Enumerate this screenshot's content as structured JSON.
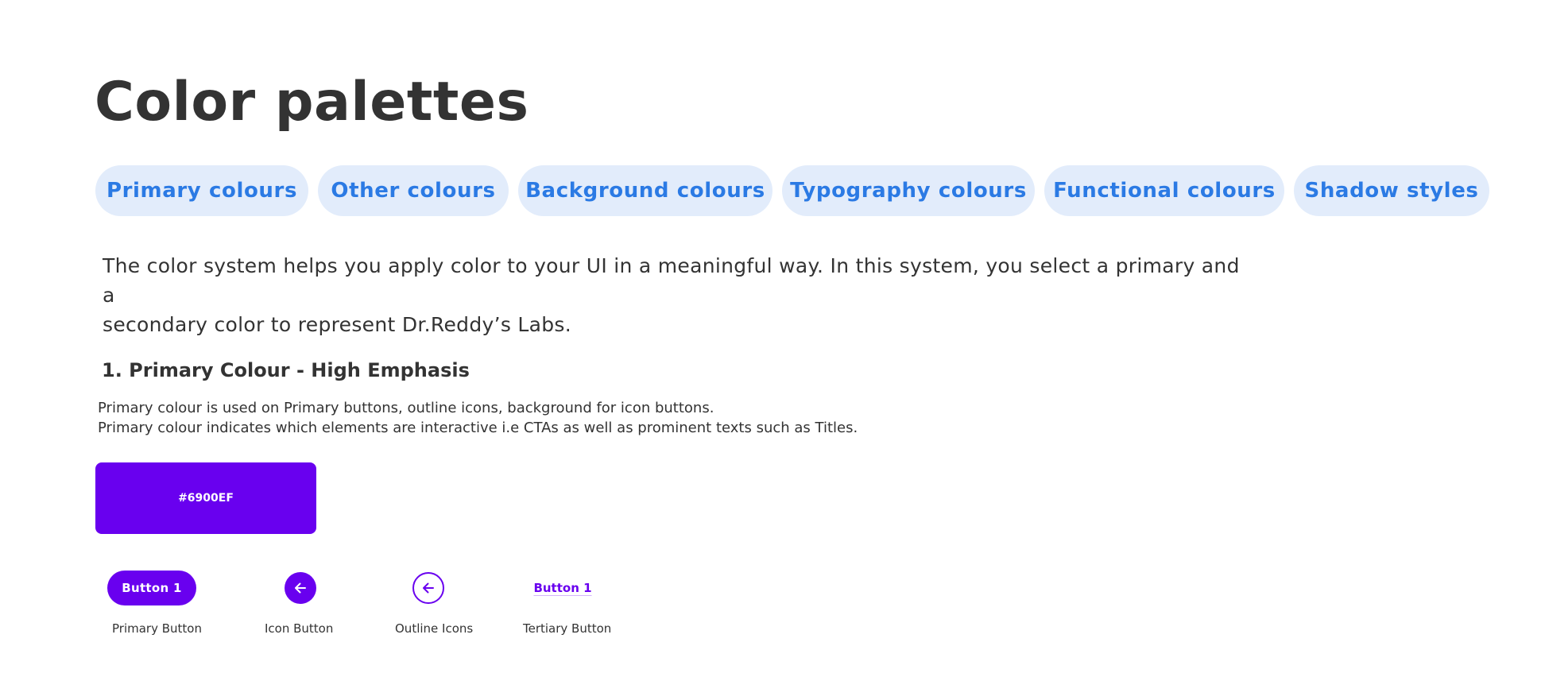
{
  "page": {
    "title": "Color palettes"
  },
  "tabs": [
    {
      "label": "Primary colours"
    },
    {
      "label": "Other colours"
    },
    {
      "label": "Background colours"
    },
    {
      "label": "Typography colours"
    },
    {
      "label": "Functional colours"
    },
    {
      "label": "Shadow styles"
    }
  ],
  "intro": {
    "line1": "The color system helps you apply color to your UI in a meaningful way. In this system, you select a primary and a",
    "line2": "secondary color to represent Dr.Reddy’s Labs."
  },
  "section": {
    "heading": "1. Primary Colour - High Emphasis",
    "desc_line1": "Primary colour is used on Primary buttons, outline icons, background for icon buttons.",
    "desc_line2": "Primary colour indicates which elements are interactive i.e CTAs as well as prominent texts such as Titles.",
    "swatch_label": "#6900EF"
  },
  "colors": {
    "primary": "#6900EF",
    "tab_bg": "#E2ECFB",
    "tab_text": "#2B7AE4",
    "text": "#333333"
  },
  "examples": {
    "primary_button_label": "Button 1",
    "primary_button_caption": "Primary Button",
    "icon_button_icon": "arrow-left-icon",
    "icon_button_caption": "Icon Button",
    "outline_icon_icon": "arrow-left-icon",
    "outline_icon_caption": "Outline Icons",
    "tertiary_button_label": "Button 1",
    "tertiary_button_caption": "Tertiary Button"
  }
}
